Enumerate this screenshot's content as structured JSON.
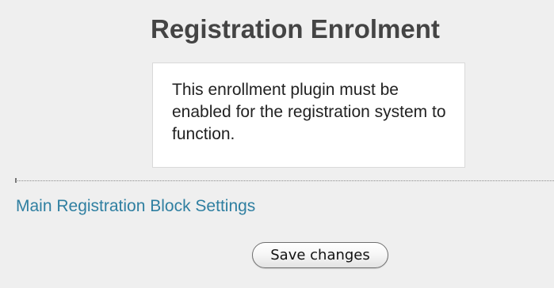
{
  "page": {
    "title": "Registration Enrolment"
  },
  "notice": {
    "message": "This enrollment plugin must be enabled for the registration system to function."
  },
  "links": {
    "main_settings": "Main Registration Block Settings"
  },
  "form": {
    "save_label": "Save changes"
  },
  "colors": {
    "background": "#efefef",
    "title": "#444444",
    "link": "#2f7fa1",
    "notice_background": "#ffffff"
  }
}
